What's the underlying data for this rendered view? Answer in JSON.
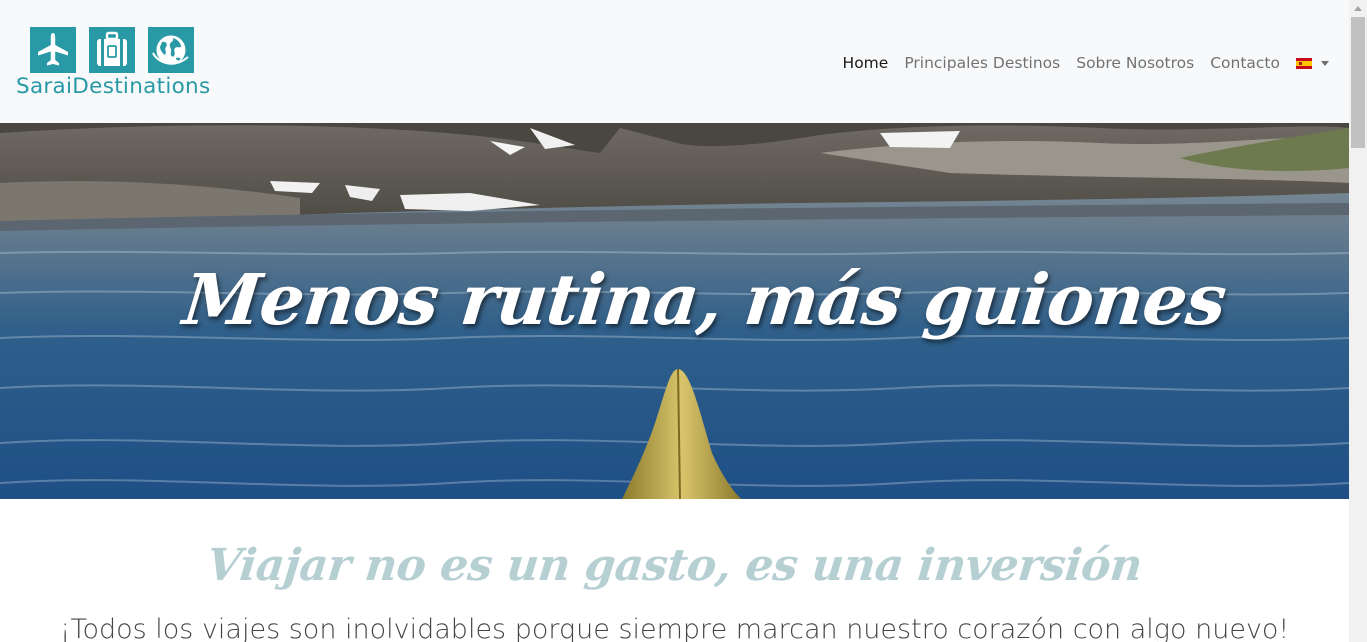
{
  "brand": {
    "name": "SaraiDestinations",
    "color": "#2899a5",
    "icons": [
      "airplane-icon",
      "suitcase-icon",
      "globe-icon"
    ]
  },
  "nav": {
    "items": [
      {
        "label": "Home",
        "active": true
      },
      {
        "label": "Principales Destinos",
        "active": false
      },
      {
        "label": "Sobre Nosotros",
        "active": false
      },
      {
        "label": "Contacto",
        "active": false
      }
    ],
    "language": "spain-flag-icon"
  },
  "hero": {
    "title": "Menos rutina, más guiones"
  },
  "content": {
    "title": "Viajar no es un gasto, es una inversión",
    "subtitle": "¡Todos los viajes son inolvidables porque siempre marcan nuestro corazón con algo nuevo!",
    "title_color": "#b6cfd3"
  }
}
